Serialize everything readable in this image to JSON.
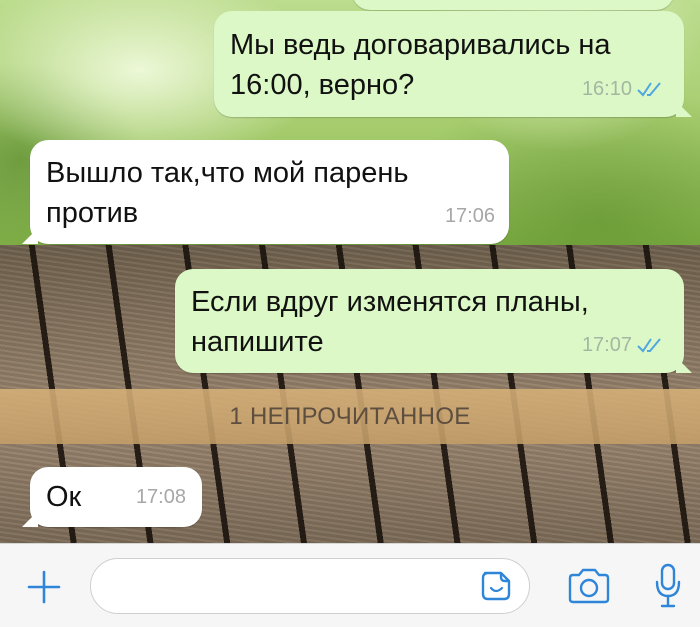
{
  "colors": {
    "outgoing_bubble": "#dcf8c6",
    "incoming_bubble": "#ffffff",
    "accent_blue": "#2f86d9",
    "read_ticks": "#4fa6e3"
  },
  "messages": [
    {
      "direction": "outgoing",
      "text": "",
      "time": "",
      "status": "read"
    },
    {
      "direction": "outgoing",
      "text": "Мы ведь договаривались на\n16:00, верно?",
      "time": "16:10",
      "status": "read"
    },
    {
      "direction": "incoming",
      "text": "Вышло так,что мой парень\nпротив",
      "time": "17:06"
    },
    {
      "direction": "outgoing",
      "text": "Если вдруг изменятся планы,\nнапишите",
      "time": "17:07",
      "status": "read"
    },
    {
      "direction": "incoming",
      "text": "Ок",
      "time": "17:08"
    }
  ],
  "unread_divider": {
    "label": "1 НЕПРОЧИТАННОЕ"
  },
  "input_bar": {
    "placeholder": "",
    "icons": [
      "plus-icon",
      "sticker-icon",
      "camera-icon",
      "microphone-icon"
    ]
  }
}
